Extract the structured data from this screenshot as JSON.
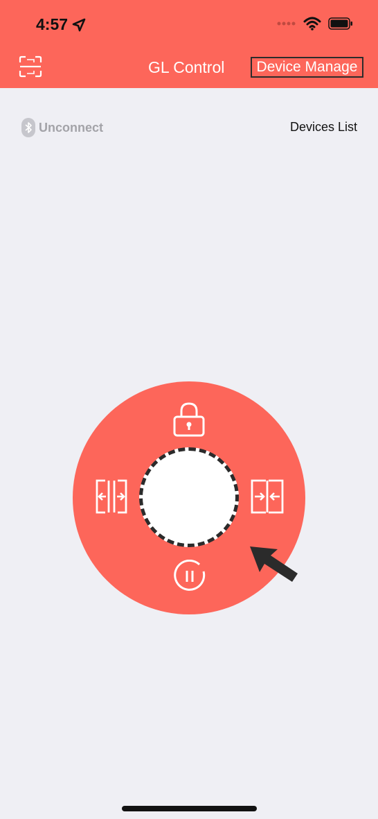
{
  "status_bar": {
    "time": "4:57",
    "icons": [
      "location-arrow-icon",
      "cellular-dots-icon",
      "wifi-icon",
      "battery-icon"
    ]
  },
  "header": {
    "title": "GL Control",
    "device_manage_label": "Device Manage",
    "scan_icon": "scan-frame-icon",
    "background_color": "#fd665a"
  },
  "connection": {
    "status_text": "Unconnect",
    "icon": "bluetooth-icon",
    "devices_list_label": "Devices List"
  },
  "control_wheel": {
    "buttons": [
      "lock-icon",
      "expand-left-right-icon",
      "compress-left-right-icon",
      "pause-icon"
    ],
    "accent_color": "#fd665a"
  },
  "overlay": {
    "pointer": "pointer-arrow-icon"
  }
}
